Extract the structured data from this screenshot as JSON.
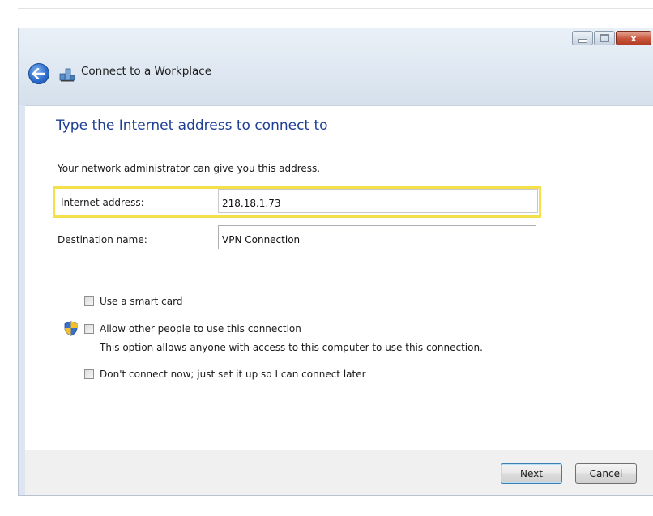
{
  "window": {
    "title": "Connect to a Workplace"
  },
  "titlebar_controls": {
    "close_glyph": "x"
  },
  "page": {
    "heading": "Type the Internet address to connect to",
    "subtext": "Your network administrator can give you this address."
  },
  "fields": {
    "internet_address": {
      "label": "Internet address:",
      "value": "218.18.1.73"
    },
    "destination_name": {
      "label": "Destination name:",
      "value": "VPN Connection"
    }
  },
  "options": {
    "smart_card": {
      "label": "Use a smart card",
      "checked": false
    },
    "allow_others": {
      "label": "Allow other people to use this connection",
      "description": "This option allows anyone with access to this computer to use this connection.",
      "checked": false
    },
    "dont_connect": {
      "label": "Don't connect now; just set it up so I can connect later",
      "checked": false
    }
  },
  "buttons": {
    "next": "Next",
    "cancel": "Cancel"
  },
  "colors": {
    "heading": "#1e3f95",
    "highlight": "#f4e04a",
    "titlebar": "#dfe8f2",
    "footer": "#f0f0f0"
  }
}
